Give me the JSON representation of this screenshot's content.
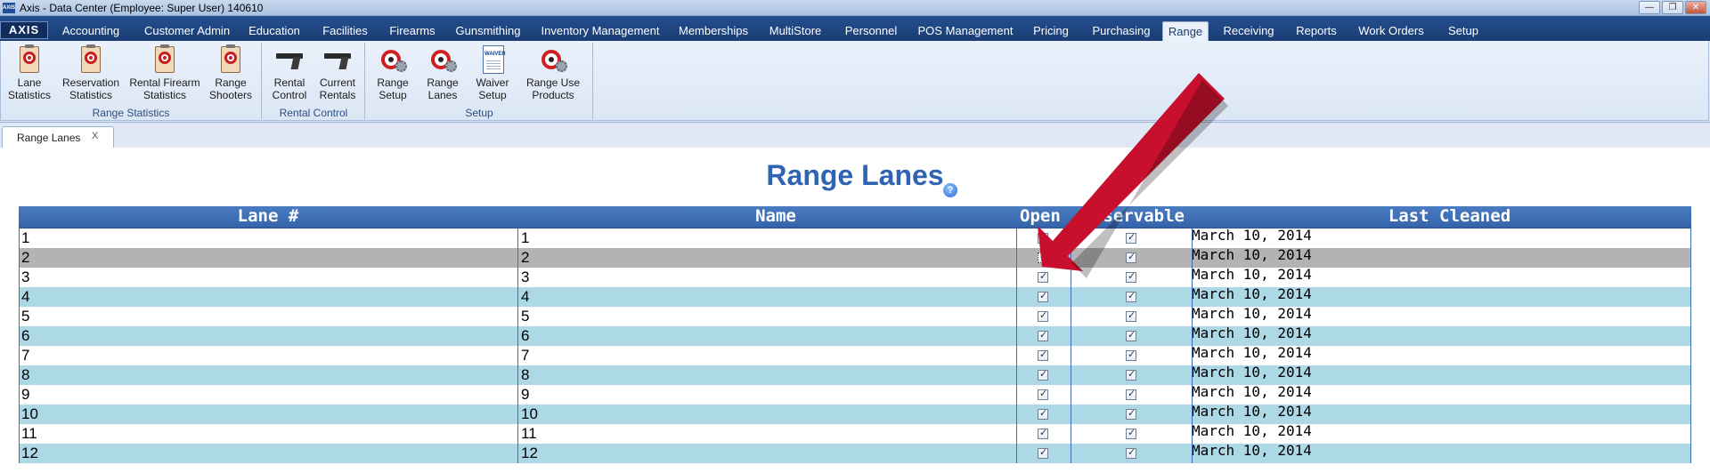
{
  "window": {
    "title": "Axis - Data Center  (Employee: Super User) 140610",
    "app_logo": "AXIS",
    "controls": [
      "minimize-icon",
      "restore-icon",
      "close-icon"
    ],
    "minimize_glyph": "—",
    "restore_glyph": "❐",
    "close_glyph": "✕"
  },
  "menu": {
    "items": [
      "Accounting",
      "Customer Admin",
      "Education",
      "Facilities",
      "Firearms",
      "Gunsmithing",
      "Inventory Management",
      "Memberships",
      "MultiStore",
      "Personnel",
      "POS Management",
      "Pricing",
      "Purchasing",
      "Range",
      "Receiving",
      "Reports",
      "Work Orders",
      "Setup"
    ],
    "active": "Range"
  },
  "ribbon": {
    "groups": [
      {
        "label": "Range Statistics",
        "buttons": [
          {
            "line1": "Lane",
            "line2": "Statistics",
            "icon": "target-clipboard-icon"
          },
          {
            "line1": "Reservation",
            "line2": "Statistics",
            "icon": "target-clipboard-icon"
          },
          {
            "line1": "Rental Firearm",
            "line2": "Statistics",
            "icon": "pistol-clipboard-icon"
          },
          {
            "line1": "Range",
            "line2": "Shooters",
            "icon": "shooter-clipboard-icon"
          }
        ]
      },
      {
        "label": "Rental Control",
        "buttons": [
          {
            "line1": "Rental",
            "line2": "Control",
            "icon": "pistol-icon"
          },
          {
            "line1": "Current",
            "line2": "Rentals",
            "icon": "pistol-icon"
          }
        ]
      },
      {
        "label": "Setup",
        "buttons": [
          {
            "line1": "Range",
            "line2": "Setup",
            "icon": "target-gear-icon"
          },
          {
            "line1": "Range",
            "line2": "Lanes",
            "icon": "target-gear-icon"
          },
          {
            "line1": "Waiver",
            "line2": "Setup",
            "icon": "waiver-document-icon"
          },
          {
            "line1": "Range Use",
            "line2": "Products",
            "icon": "target-gear-icon"
          }
        ]
      }
    ],
    "waiver_icon_text": "WAIVER"
  },
  "doc_tab": {
    "label": "Range Lanes",
    "close": "X"
  },
  "page": {
    "title": "Range Lanes",
    "help_glyph": "?"
  },
  "grid": {
    "columns": [
      "Lane #",
      "Name",
      "Open",
      "Reservable",
      "Last Cleaned"
    ],
    "header_visible": [
      "Lane #",
      "Name",
      "Open",
      "eservable",
      "Last Cleaned"
    ],
    "rows": [
      {
        "lane": "1",
        "name": "1",
        "open": true,
        "reservable": true,
        "last_cleaned": "March 10, 2014"
      },
      {
        "lane": "2",
        "name": "2",
        "open": true,
        "reservable": true,
        "last_cleaned": "March 10, 2014"
      },
      {
        "lane": "3",
        "name": "3",
        "open": true,
        "reservable": true,
        "last_cleaned": "March 10, 2014"
      },
      {
        "lane": "4",
        "name": "4",
        "open": true,
        "reservable": true,
        "last_cleaned": "March 10, 2014"
      },
      {
        "lane": "5",
        "name": "5",
        "open": true,
        "reservable": true,
        "last_cleaned": "March 10, 2014"
      },
      {
        "lane": "6",
        "name": "6",
        "open": true,
        "reservable": true,
        "last_cleaned": "March 10, 2014"
      },
      {
        "lane": "7",
        "name": "7",
        "open": true,
        "reservable": true,
        "last_cleaned": "March 10, 2014"
      },
      {
        "lane": "8",
        "name": "8",
        "open": true,
        "reservable": true,
        "last_cleaned": "March 10, 2014"
      },
      {
        "lane": "9",
        "name": "9",
        "open": true,
        "reservable": true,
        "last_cleaned": "March 10, 2014"
      },
      {
        "lane": "10",
        "name": "10",
        "open": true,
        "reservable": true,
        "last_cleaned": "March 10, 2014"
      },
      {
        "lane": "11",
        "name": "11",
        "open": true,
        "reservable": true,
        "last_cleaned": "March 10, 2014"
      },
      {
        "lane": "12",
        "name": "12",
        "open": true,
        "reservable": true,
        "last_cleaned": "March 10, 2014"
      }
    ],
    "selected_row": 2,
    "focused_checkbox_row": 2
  },
  "colors": {
    "row_white": "#ffffff",
    "row_alt": "#add8e6",
    "row_selected": "#b3b3b3",
    "header_blue": "#3f70b8",
    "title_blue": "#2e64b3",
    "arrow_red": "#c8102e"
  },
  "annotation": {
    "type": "pointer-arrow",
    "color": "#c8102e"
  }
}
